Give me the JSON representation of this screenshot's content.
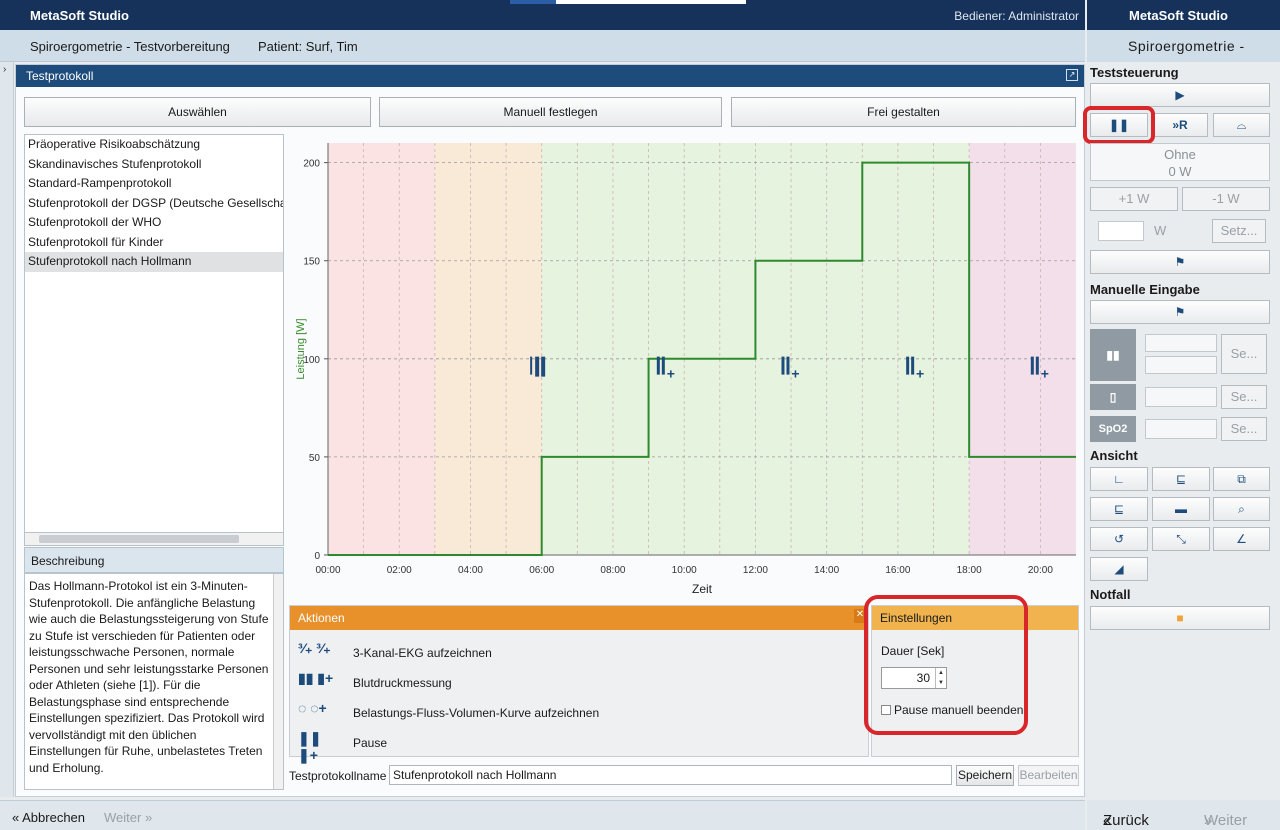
{
  "app": {
    "title": "MetaSoft Studio",
    "operator": "Bediener: Administrator"
  },
  "subheader": {
    "title": "Spiroergometrie - Testvorbereitung",
    "patient": "Patient: Surf, Tim"
  },
  "panel": {
    "title": "Testprotokoll"
  },
  "modes": [
    "Auswählen",
    "Manuell festlegen",
    "Frei gestalten"
  ],
  "protocols": [
    "Präoperative Risikoabschätzung",
    "Skandinavisches Stufenprotokoll",
    "Standard-Rampenprotokoll",
    "Stufenprotokoll der DGSP (Deutsche Gesellschaft",
    "Stufenprotokoll der WHO",
    "Stufenprotokoll für Kinder",
    "Stufenprotokoll nach Hollmann"
  ],
  "selected_protocol_index": 6,
  "description": {
    "heading": "Beschreibung",
    "text": "Das Hollmann-Protokol ist ein 3-Minuten-Stufenprotokoll. Die anfängliche Belastung wie auch die Belastungssteigerung von Stufe zu Stufe ist verschieden für Patienten oder leistungsschwache Personen, normale Personen und sehr leistungsstarke Personen oder Athleten (siehe [1]). Für die Belastungsphase sind entsprechende Einstellungen spezifiziert. Das Protokoll wird vervollständigt mit den üblichen Einstellungen für Ruhe, unbelastetes Treten und Erholung."
  },
  "chart_data": {
    "type": "line",
    "xlabel": "Zeit",
    "ylabel": "Leistung [W]",
    "x_ticks": [
      "00:00",
      "02:00",
      "04:00",
      "06:00",
      "08:00",
      "10:00",
      "12:00",
      "14:00",
      "16:00",
      "18:00",
      "20:00"
    ],
    "y_ticks": [
      0,
      50,
      100,
      150,
      200
    ],
    "xlim_minutes": [
      0,
      21
    ],
    "ylim": [
      0,
      210
    ],
    "series": [
      {
        "color": "#2f8a2f",
        "points_minutes_watts": [
          [
            0,
            0
          ],
          [
            6,
            0
          ],
          [
            6,
            50
          ],
          [
            9,
            50
          ],
          [
            9,
            100
          ],
          [
            12,
            100
          ],
          [
            12,
            150
          ],
          [
            15,
            150
          ],
          [
            15,
            200
          ],
          [
            18,
            200
          ],
          [
            18,
            50
          ],
          [
            21,
            50
          ]
        ]
      }
    ],
    "phases": [
      {
        "from": 0,
        "to": 3,
        "color": "#fbe3e3"
      },
      {
        "from": 3,
        "to": 6,
        "color": "#f8ead7"
      },
      {
        "from": 6,
        "to": 18,
        "color": "#e6f3df"
      },
      {
        "from": 18,
        "to": 21,
        "color": "#f3dfea"
      }
    ],
    "markers_minutes": [
      {
        "t": 5.9,
        "icon": "pause"
      },
      {
        "t": 9.4,
        "icon": "pause-add"
      },
      {
        "t": 12.9,
        "icon": "pause-add"
      },
      {
        "t": 16.4,
        "icon": "pause-add"
      },
      {
        "t": 19.9,
        "icon": "pause-add"
      }
    ],
    "marker_level_watts": 95,
    "grid": true
  },
  "actions": {
    "title": "Aktionen",
    "items": [
      {
        "label": "3-Kanal-EKG aufzeichnen",
        "icon": "ecg-icon"
      },
      {
        "label": "Blutdruckmessung",
        "icon": "blood-pressure-icon"
      },
      {
        "label": "Belastungs-Fluss-Volumen-Kurve aufzeichnen",
        "icon": "flow-volume-icon"
      },
      {
        "label": "Pause",
        "icon": "pause-icon"
      }
    ]
  },
  "settings": {
    "title": "Einstellungen",
    "duration_label": "Dauer [Sek]",
    "duration_value": "30",
    "pause_manual_label": "Pause manuell beenden"
  },
  "protocol_name": {
    "label": "Testprotokollname",
    "value": "Stufenprotokoll nach Hollmann"
  },
  "buttons": {
    "save": "Speichern",
    "edit": "Bearbeiten"
  },
  "footer": {
    "cancel": "Abbrechen",
    "next": "Weiter"
  },
  "right_panel": {
    "app_title": "MetaSoft Studio",
    "subtitle": "Spiroergometrie -",
    "test_control": "Teststeuerung",
    "skip_label": "»R",
    "load_label": "Ohne",
    "load_value": "0 W",
    "plus_label": "+1 W",
    "minus_label": "-1 W",
    "w_unit": "W",
    "set_label": "Setz...",
    "manual_entry": "Manuelle Eingabe",
    "se_label": "Se...",
    "spo2_label": "SpO2",
    "view": "Ansicht",
    "emergency": "Notfall",
    "back": "Zurück",
    "next": "Weiter"
  },
  "colors": {
    "accent_blue": "#1d4c7c",
    "orange": "#e8902a",
    "highlight_red": "#d9262b",
    "curve_green": "#2f8a2f"
  }
}
